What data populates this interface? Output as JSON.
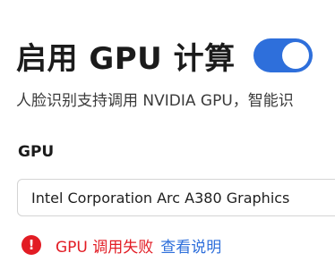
{
  "header": {
    "title": "启用 GPU 计算",
    "toggle_on": true,
    "accent_color": "#2e6fdb"
  },
  "description": "人脸识别支持调用 NVIDIA GPU，智能识",
  "gpu": {
    "label": "GPU",
    "selected_value": "Intel Corporation Arc A380 Graphics"
  },
  "status": {
    "icon": "error-icon",
    "icon_glyph": "!",
    "error_text": "GPU 调用失败",
    "error_color": "#e21c24",
    "help_link": "查看说明"
  }
}
